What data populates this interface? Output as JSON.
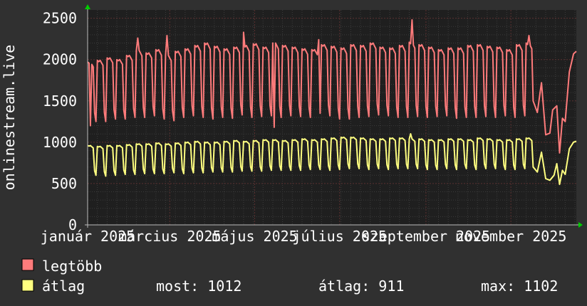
{
  "chart_data": {
    "type": "line",
    "ylabel": "onlinestream.live",
    "ylim": [
      0,
      2600
    ],
    "grid": true,
    "yticks": [
      0,
      500,
      1000,
      1500,
      2000,
      2500
    ],
    "yticklabels": [
      "0",
      "500",
      "1000",
      "1500",
      "2000",
      "2500"
    ],
    "xticks": [
      {
        "label": "január 2025",
        "day": 0
      },
      {
        "label": "március 2025",
        "day": 59
      },
      {
        "label": "május 2025",
        "day": 120
      },
      {
        "label": "július 2025",
        "day": 181
      },
      {
        "label": "szeptember 2025",
        "day": 243
      },
      {
        "label": "november 2025",
        "day": 304
      }
    ],
    "colors": {
      "background": "#303030",
      "plot": "#1f1f1f",
      "grid_major": "#5a3030",
      "grid_minor": "#3b3b3b",
      "legtobb": "#ff7b7b",
      "atlag": "#ffff80",
      "axis_arrow": "#00cc00"
    },
    "series": [
      {
        "name": "legtöbb",
        "color": "#ff7b7b",
        "weekly_peak": [
          1970,
          1990,
          2020,
          2000,
          2050,
          2110,
          2080,
          2120,
          2050,
          2100,
          2130,
          2170,
          2200,
          2160,
          2130,
          2150,
          2170,
          2190,
          2150,
          2200,
          2170,
          2150,
          2130,
          2120,
          2180,
          2160,
          2140,
          2180,
          2170,
          2200,
          2150,
          2140,
          2170,
          2210,
          2180,
          2150,
          2120,
          2140,
          2140,
          2170,
          2180,
          2160,
          2150,
          2120,
          2180,
          2200,
          2190,
          2140,
          2150,
          2140,
          2170,
          2110
        ],
        "weekly_trough": [
          1250,
          1250,
          1280,
          1280,
          1300,
          1300,
          1320,
          1280,
          1260,
          1300,
          1320,
          1300,
          1280,
          1300,
          1290,
          1330,
          1300,
          1310,
          1320,
          1300,
          1320,
          1310,
          1300,
          1350,
          1320,
          1280,
          1280,
          1300,
          1310,
          1330,
          1320,
          1300,
          1300,
          1310,
          1300,
          1310,
          1320,
          1290,
          1300,
          1300,
          1310,
          1300,
          1320,
          1300,
          1320,
          1330,
          1320,
          1300,
          1350,
          1330,
          1350,
          1330
        ],
        "spikes": [
          {
            "day": 2,
            "value": 1200
          },
          {
            "day": 36,
            "value": 2260
          },
          {
            "day": 57,
            "value": 2290
          },
          {
            "day": 112,
            "value": 2330
          },
          {
            "day": 134,
            "value": 1180
          },
          {
            "day": 166,
            "value": 2240
          },
          {
            "day": 233,
            "value": 2480
          },
          {
            "day": 317,
            "value": 2290
          }
        ],
        "tail": [
          [
            320,
            1500
          ],
          [
            323,
            1360
          ],
          [
            326,
            1720
          ],
          [
            329,
            1090
          ],
          [
            332,
            1110
          ],
          [
            334,
            1390
          ],
          [
            337,
            1440
          ],
          [
            339,
            870
          ],
          [
            341,
            1290
          ],
          [
            343,
            1250
          ],
          [
            346,
            1850
          ],
          [
            349,
            2070
          ],
          [
            351,
            2100
          ]
        ]
      },
      {
        "name": "átlag",
        "color": "#ffff80",
        "weekly_peak": [
          960,
          950,
          960,
          960,
          970,
          980,
          980,
          990,
          980,
          990,
          1000,
          1010,
          1000,
          1000,
          1010,
          1020,
          1010,
          1020,
          1030,
          1030,
          1020,
          1030,
          1040,
          1030,
          1040,
          1050,
          1060,
          1060,
          1050,
          1040,
          1040,
          1050,
          1050,
          1040,
          1040,
          1030,
          1030,
          1040,
          1040,
          1030,
          1050,
          1040,
          1030,
          1030,
          1040,
          1050,
          1040,
          1030,
          1030,
          1020,
          1020,
          1010
        ],
        "weekly_trough": [
          600,
          590,
          600,
          610,
          610,
          620,
          620,
          620,
          630,
          620,
          630,
          630,
          640,
          640,
          640,
          650,
          650,
          650,
          660,
          660,
          660,
          660,
          670,
          670,
          660,
          670,
          680,
          680,
          670,
          680,
          670,
          680,
          680,
          680,
          670,
          670,
          680,
          670,
          680,
          670,
          680,
          680,
          670,
          670,
          680,
          670,
          680,
          670,
          670,
          680,
          670,
          670
        ],
        "spikes": [
          {
            "day": 232,
            "value": 1102
          }
        ],
        "tail": [
          [
            320,
            700
          ],
          [
            323,
            640
          ],
          [
            326,
            880
          ],
          [
            329,
            560
          ],
          [
            332,
            540
          ],
          [
            335,
            600
          ],
          [
            337,
            740
          ],
          [
            339,
            490
          ],
          [
            341,
            660
          ],
          [
            343,
            610
          ],
          [
            346,
            920
          ],
          [
            349,
            1000
          ],
          [
            351,
            1012
          ]
        ]
      }
    ],
    "legend": [
      {
        "label": "legtöbb",
        "color": "#ff7b7b"
      },
      {
        "label": "átlag",
        "color": "#ffff80"
      }
    ],
    "stats": {
      "most": "most: 1012",
      "atlag": "átlag: 911",
      "max": "max: 1102"
    }
  }
}
